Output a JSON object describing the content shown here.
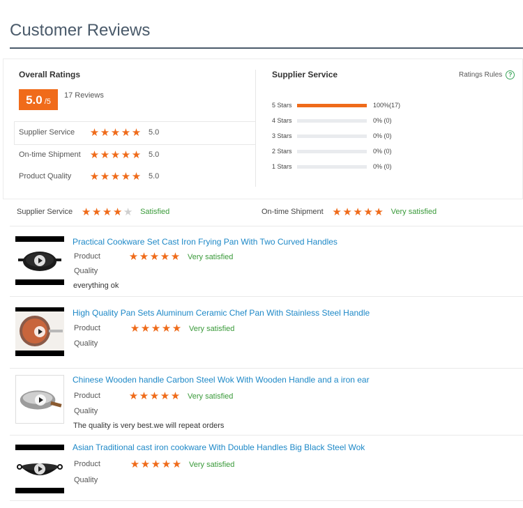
{
  "page": {
    "title": "Customer Reviews"
  },
  "overall": {
    "heading": "Overall Ratings",
    "score": "5.0",
    "score_suffix": "/5",
    "reviews_count": "17 Reviews",
    "sub_ratings": [
      {
        "label": "Supplier Service",
        "stars": 5,
        "value": "5.0"
      },
      {
        "label": "On-time Shipment",
        "stars": 5,
        "value": "5.0"
      },
      {
        "label": "Product Quality",
        "stars": 5,
        "value": "5.0"
      }
    ]
  },
  "supplier": {
    "heading": "Supplier Service",
    "rules_label": "Ratings Rules",
    "distribution": [
      {
        "label": "5 Stars",
        "percent": 100,
        "pct_text": "100%",
        "count": "(17)"
      },
      {
        "label": "4 Stars",
        "percent": 0,
        "pct_text": "0%",
        "count": "(0)"
      },
      {
        "label": "3 Stars",
        "percent": 0,
        "pct_text": "0%",
        "count": "(0)"
      },
      {
        "label": "2 Stars",
        "percent": 0,
        "pct_text": "0%",
        "count": "(0)"
      },
      {
        "label": "1 Stars",
        "percent": 0,
        "pct_text": "0%",
        "count": "(0)"
      }
    ]
  },
  "service_summary": [
    {
      "label": "Supplier Service",
      "stars": 4,
      "status": "Satisfied"
    },
    {
      "label": "On-time Shipment",
      "stars": 5,
      "status": "Very satisfied"
    }
  ],
  "reviews": [
    {
      "title": "Practical Cookware Set Cast Iron Frying Pan With Two Curved Handles",
      "product_label": "Product",
      "quality_label": "Quality",
      "stars": 5,
      "status": "Very satisfied",
      "comment": "everything ok"
    },
    {
      "title": "High Quality Pan Sets Aluminum Ceramic Chef Pan With Stainless Steel Handle",
      "product_label": "Product",
      "quality_label": "Quality",
      "stars": 5,
      "status": "Very satisfied",
      "comment": ""
    },
    {
      "title": "Chinese Wooden handle Carbon Steel Wok With Wooden Handle and a iron ear",
      "product_label": "Product",
      "quality_label": "Quality",
      "stars": 5,
      "status": "Very satisfied",
      "comment": "The quality is very best.we will repeat orders"
    },
    {
      "title": "Asian Traditional cast iron cookware With Double Handles Big Black Steel Wok",
      "product_label": "Product",
      "quality_label": "Quality",
      "stars": 5,
      "status": "Very satisfied",
      "comment": ""
    }
  ],
  "colors": {
    "accent": "#ef6b1a",
    "link": "#1d88c7",
    "satisfied": "#3a9a3a",
    "title": "#4a5a6a"
  },
  "icons": {
    "star": "star-icon",
    "help": "help-icon",
    "play": "play-icon"
  }
}
